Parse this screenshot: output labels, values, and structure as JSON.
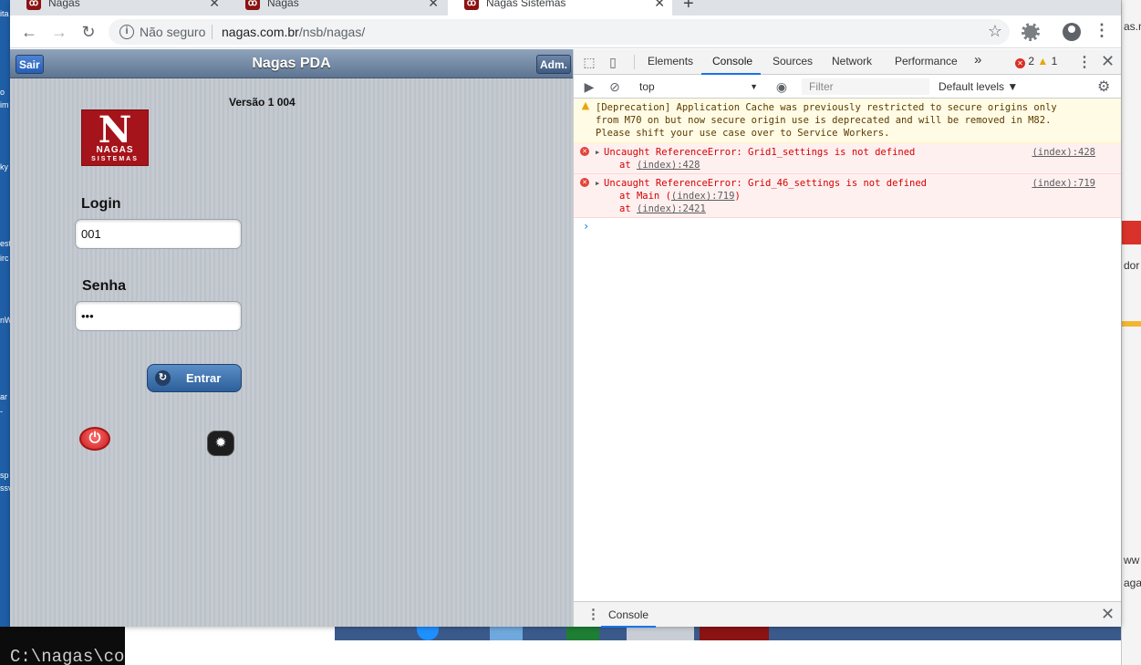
{
  "background": {
    "left_fragments": [
      "ita",
      "o",
      "im",
      "ky",
      "est",
      "irc",
      "nW",
      "ar",
      "-",
      "sp",
      "ssv"
    ],
    "right_fragments": [
      "as.n",
      "dor",
      "ww",
      "aga"
    ],
    "cmd_text": "C:\\nagas\\cor"
  },
  "browser": {
    "tabs": [
      {
        "label": "Nagas",
        "icon": "nagas-favicon"
      },
      {
        "label": "Nagas",
        "icon": "nagas-favicon"
      },
      {
        "label": "Nagas Sistemas",
        "icon": "nagas-favicon"
      }
    ],
    "security_label": "Não seguro",
    "url_host": "nagas.com.br",
    "url_path": "/nsb/nagas/"
  },
  "pda": {
    "title": "Nagas PDA",
    "left_button": "Sair",
    "right_button": "Adm.",
    "version": "Versão 1 004",
    "logo": {
      "letter": "N",
      "line1": "NAGAS",
      "line2": "SISTEMAS"
    },
    "login_label": "Login",
    "login_value": "001",
    "password_label": "Senha",
    "password_value": "•••",
    "submit_label": "Entrar",
    "colors": {
      "header": "#5d7592",
      "button": "#2d5f9a",
      "power": "#c71f1f",
      "logo": "#a5141a"
    }
  },
  "devtools": {
    "tabs": [
      "Elements",
      "Console",
      "Sources",
      "Network",
      "Performance"
    ],
    "active_tab": "Console",
    "more": "»",
    "error_count": "2",
    "warning_count": "1",
    "context": "top",
    "filter_placeholder": "Filter",
    "levels": "Default levels ▼",
    "messages": {
      "warning": {
        "lines": [
          "[Deprecation] Application Cache was previously restricted to secure origins only",
          "from M70 on but now secure origin use is deprecated and will be removed in M82.",
          "Please shift your use case over to Service Workers."
        ]
      },
      "error1": {
        "text": "Uncaught ReferenceError: Grid1_settings is not defined",
        "source": "(index):428",
        "stack_prefix": "at ",
        "stack_link": "(index):428"
      },
      "error2": {
        "text": "Uncaught ReferenceError: Grid_46_settings is not defined",
        "source": "(index):719",
        "stack1_prefix": "at Main (",
        "stack1_link": "(index):719",
        "stack1_suffix": ")",
        "stack2_prefix": "at ",
        "stack2_link": "(index):2421"
      }
    },
    "prompt": "›",
    "drawer_tab": "Console"
  }
}
